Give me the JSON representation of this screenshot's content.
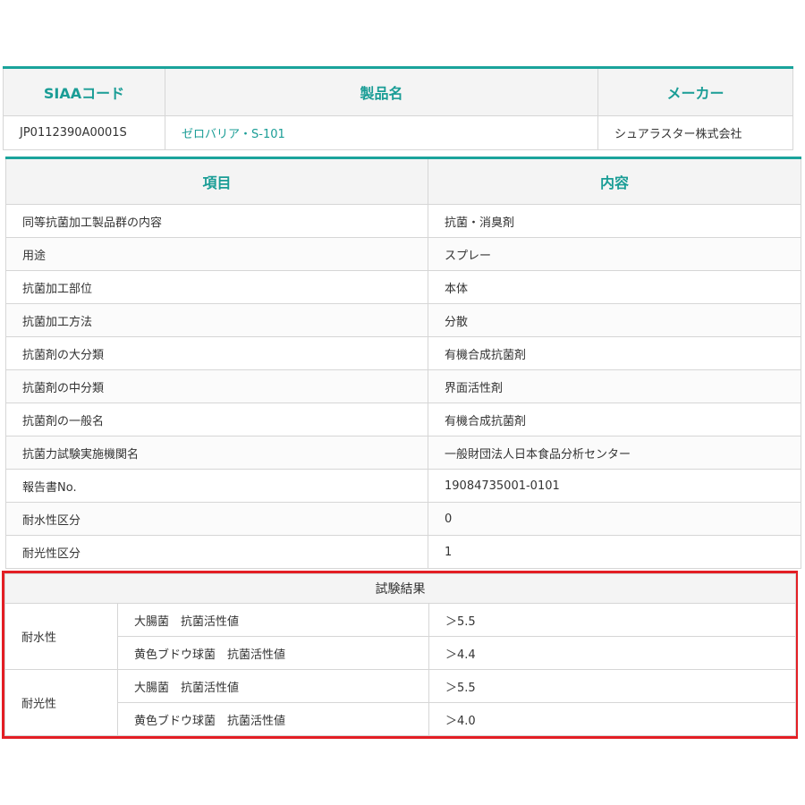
{
  "product": {
    "headers": [
      "SIAAコード",
      "製品名",
      "メーカー"
    ],
    "code": "JP0112390A0001S",
    "name": "ゼロバリア・S-101",
    "maker": "シュアラスター株式会社"
  },
  "details": {
    "headers": [
      "項目",
      "内容"
    ],
    "rows": [
      {
        "item": "同等抗菌加工製品群の内容",
        "value": "抗菌・消臭剤"
      },
      {
        "item": "用途",
        "value": "スプレー"
      },
      {
        "item": "抗菌加工部位",
        "value": "本体"
      },
      {
        "item": "抗菌加工方法",
        "value": "分散"
      },
      {
        "item": "抗菌剤の大分類",
        "value": "有機合成抗菌剤"
      },
      {
        "item": "抗菌剤の中分類",
        "value": "界面活性剤"
      },
      {
        "item": "抗菌剤の一般名",
        "value": "有機合成抗菌剤"
      },
      {
        "item": "抗菌力試験実施機関名",
        "value": "一般財団法人日本食品分析センター"
      },
      {
        "item": "報告書No.",
        "value": "19084735001-0101"
      },
      {
        "item": "耐水性区分",
        "value": "0"
      },
      {
        "item": "耐光性区分",
        "value": "1"
      }
    ]
  },
  "results": {
    "caption": "試験結果",
    "groups": [
      {
        "label": "耐水性",
        "rows": [
          {
            "test": "大腸菌　抗菌活性値",
            "value": "＞5.5"
          },
          {
            "test": "黄色ブドウ球菌　抗菌活性値",
            "value": "＞4.4"
          }
        ]
      },
      {
        "label": "耐光性",
        "rows": [
          {
            "test": "大腸菌　抗菌活性値",
            "value": "＞5.5"
          },
          {
            "test": "黄色ブドウ球菌　抗菌活性値",
            "value": "＞4.0"
          }
        ]
      }
    ]
  },
  "colors": {
    "accent": "#1aa39b",
    "highlight_border": "#e31e24"
  }
}
